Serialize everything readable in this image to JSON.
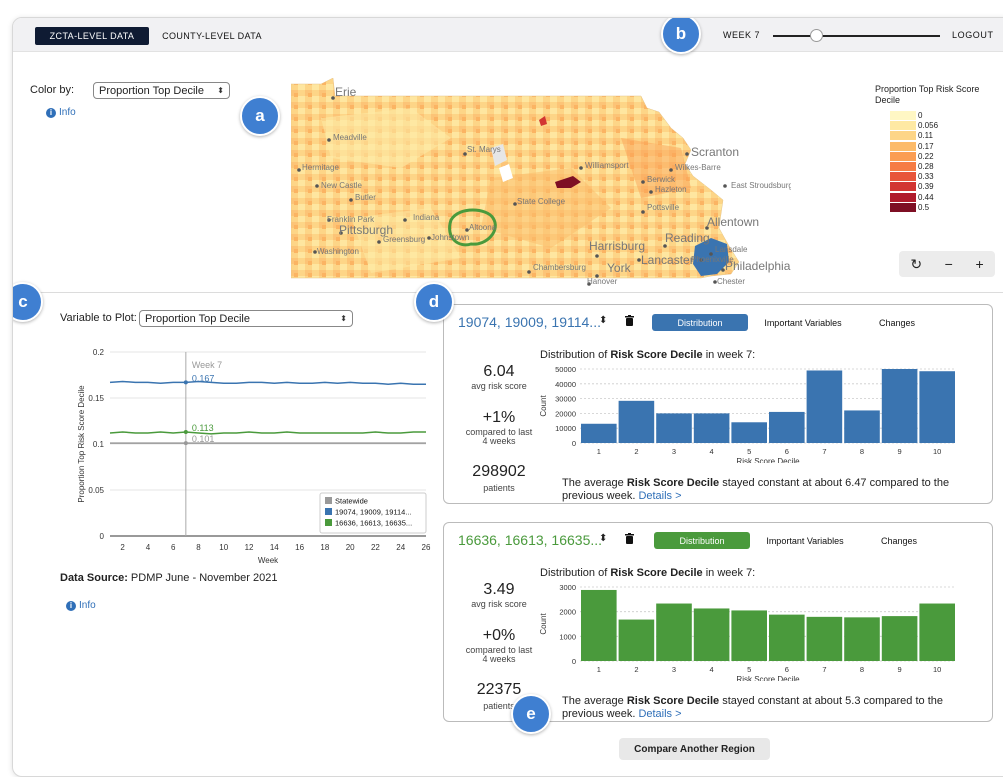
{
  "topbar": {
    "tabs": [
      {
        "label": "ZCTA-LEVEL DATA",
        "active": true
      },
      {
        "label": "COUNTY-LEVEL DATA",
        "active": false
      }
    ],
    "week_label": "WEEK 7",
    "week_value": 7,
    "week_max": 26,
    "logout_label": "LOGOUT"
  },
  "badges": {
    "a": "a",
    "b": "b",
    "c": "c",
    "d": "d",
    "e": "e"
  },
  "map_panel": {
    "color_by_label": "Color by:",
    "color_by_value": "Proportion Top Decile",
    "info_label": "Info",
    "cities": [
      "Erie",
      "Meadville",
      "Hermitage",
      "New Castle",
      "Butler",
      "Franklin Park",
      "Pittsburgh",
      "Washington",
      "Indiana",
      "Greensburg",
      "Johnstown",
      "Altoona",
      "St. Marys",
      "State College",
      "Williamsport",
      "Scranton",
      "Wilkes-Barre",
      "Berwick",
      "Hazleton",
      "East Stroudsburg",
      "Pottsville",
      "Allentown",
      "Harrisburg",
      "Reading",
      "Lansdale",
      "Phoenixville",
      "Philadelphia",
      "Chester",
      "Chambersburg",
      "York",
      "Lancaster",
      "Hanover"
    ],
    "legend_title": "Proportion Top Risk Score Decile",
    "legend": [
      {
        "label": "0",
        "color": "#fff7c4"
      },
      {
        "label": "0.056",
        "color": "#fee9a3"
      },
      {
        "label": "0.11",
        "color": "#fdd587"
      },
      {
        "label": "0.17",
        "color": "#fcbb6a"
      },
      {
        "label": "0.22",
        "color": "#fb9d53"
      },
      {
        "label": "0.28",
        "color": "#f67c45"
      },
      {
        "label": "0.33",
        "color": "#e8553a"
      },
      {
        "label": "0.39",
        "color": "#d23532"
      },
      {
        "label": "0.44",
        "color": "#b01b2c"
      },
      {
        "label": "0.5",
        "color": "#7e0f24"
      }
    ],
    "controls": {
      "reset": "↻",
      "zoom_out": "−",
      "zoom_in": "+"
    }
  },
  "line_panel": {
    "variable_label": "Variable to Plot:",
    "variable_value": "Proportion Top Decile",
    "data_source_label": "Data Source:",
    "data_source_value": "PDMP June - November 2021",
    "info_label": "Info"
  },
  "chart_data": [
    {
      "type": "line",
      "title": "",
      "xlabel": "Week",
      "ylabel": "Proportion Top Risk Score Decile",
      "xlim": [
        1,
        26
      ],
      "ylim": [
        0,
        0.2
      ],
      "x_ticks": [
        2,
        4,
        6,
        8,
        10,
        12,
        14,
        16,
        18,
        20,
        22,
        24,
        26
      ],
      "y_ticks": [
        0,
        0.05,
        0.1,
        0.15,
        0.2
      ],
      "y_tick_labels": [
        "0",
        "0.05",
        "0.1",
        "0.15",
        "0.2"
      ],
      "marker_week": 7,
      "marker_label": "Week 7",
      "legend_position": "bottom-right",
      "series": [
        {
          "name": "Statewide",
          "color": "#999999",
          "label_at_marker": "0.101",
          "x": [
            1,
            2,
            3,
            4,
            5,
            6,
            7,
            8,
            9,
            10,
            11,
            12,
            13,
            14,
            15,
            16,
            17,
            18,
            19,
            20,
            21,
            22,
            23,
            24,
            25,
            26
          ],
          "values": [
            0.101,
            0.101,
            0.101,
            0.101,
            0.101,
            0.101,
            0.101,
            0.101,
            0.101,
            0.101,
            0.101,
            0.101,
            0.101,
            0.101,
            0.101,
            0.101,
            0.101,
            0.101,
            0.101,
            0.101,
            0.101,
            0.101,
            0.101,
            0.101,
            0.101,
            0.101
          ]
        },
        {
          "name": "19074, 19009, 19114...",
          "color": "#3a74b0",
          "label_at_marker": "0.167",
          "x": [
            1,
            2,
            3,
            4,
            5,
            6,
            7,
            8,
            9,
            10,
            11,
            12,
            13,
            14,
            15,
            16,
            17,
            18,
            19,
            20,
            21,
            22,
            23,
            24,
            25,
            26
          ],
          "values": [
            0.167,
            0.168,
            0.167,
            0.167,
            0.166,
            0.167,
            0.167,
            0.168,
            0.167,
            0.166,
            0.166,
            0.167,
            0.167,
            0.166,
            0.167,
            0.166,
            0.166,
            0.167,
            0.166,
            0.167,
            0.166,
            0.166,
            0.165,
            0.166,
            0.165,
            0.165
          ]
        },
        {
          "name": "16636, 16613, 16635...",
          "color": "#4a9a3c",
          "label_at_marker": "0.113",
          "x": [
            1,
            2,
            3,
            4,
            5,
            6,
            7,
            8,
            9,
            10,
            11,
            12,
            13,
            14,
            15,
            16,
            17,
            18,
            19,
            20,
            21,
            22,
            23,
            24,
            25,
            26
          ],
          "values": [
            0.112,
            0.113,
            0.112,
            0.112,
            0.113,
            0.112,
            0.113,
            0.112,
            0.111,
            0.112,
            0.112,
            0.113,
            0.112,
            0.112,
            0.113,
            0.112,
            0.112,
            0.112,
            0.112,
            0.112,
            0.112,
            0.113,
            0.112,
            0.112,
            0.113,
            0.113
          ]
        }
      ]
    },
    {
      "type": "bar",
      "title": "Distribution of Risk Score Decile in week 7:",
      "xlabel": "Risk Score Decile",
      "ylabel": "Count",
      "categories": [
        "1",
        "2",
        "3",
        "4",
        "5",
        "6",
        "7",
        "8",
        "9",
        "10"
      ],
      "values": [
        13000,
        28500,
        20000,
        20000,
        14000,
        21000,
        49000,
        22000,
        50000,
        48500
      ],
      "ylim": [
        0,
        50000
      ],
      "y_ticks": [
        0,
        10000,
        20000,
        30000,
        40000,
        50000
      ],
      "color": "#3a74b0"
    },
    {
      "type": "bar",
      "title": "Distribution of Risk Score Decile in week 7:",
      "xlabel": "Risk Score Decile",
      "ylabel": "Count",
      "categories": [
        "1",
        "2",
        "3",
        "4",
        "5",
        "6",
        "7",
        "8",
        "9",
        "10"
      ],
      "values": [
        2880,
        1680,
        2330,
        2130,
        2050,
        1880,
        1790,
        1770,
        1820,
        2330
      ],
      "ylim": [
        0,
        3000
      ],
      "y_ticks": [
        0,
        1000,
        2000,
        3000
      ],
      "color": "#4a9a3c"
    }
  ],
  "cards": [
    {
      "title": "19074, 19009, 19114...",
      "color": "#3a74b0",
      "sort_icon": "⬍",
      "tabs": [
        "Distribution",
        "Important Variables",
        "Changes"
      ],
      "avg_value": "6.04",
      "avg_label": "avg risk score",
      "change_value": "+1%",
      "change_label_1": "compared to last",
      "change_label_2": "4 weeks",
      "patients_value": "298902",
      "patients_label": "patients",
      "dist_prefix": "Distribution of ",
      "dist_bold": "Risk Score Decile",
      "dist_suffix": " in week 7:",
      "summary_prefix": "The average ",
      "summary_bold": "Risk Score Decile",
      "summary_suffix": " stayed constant at about 6.47 compared to the previous week.",
      "details_link": "Details >"
    },
    {
      "title": "16636, 16613, 16635...",
      "color": "#4a9a3c",
      "sort_icon": "⬍",
      "tabs": [
        "Distribution",
        "Important Variables",
        "Changes"
      ],
      "avg_value": "3.49",
      "avg_label": "avg risk score",
      "change_value": "+0%",
      "change_label_1": "compared to last",
      "change_label_2": "4 weeks",
      "patients_value": "22375",
      "patients_label": "patients",
      "dist_prefix": "Distribution of ",
      "dist_bold": "Risk Score Decile",
      "dist_suffix": " in week 7:",
      "summary_prefix": "The average ",
      "summary_bold": "Risk Score Decile",
      "summary_suffix": " stayed constant at about 5.3 compared to the previous week.",
      "details_link": "Details >"
    }
  ],
  "compare_button": "Compare Another Region"
}
